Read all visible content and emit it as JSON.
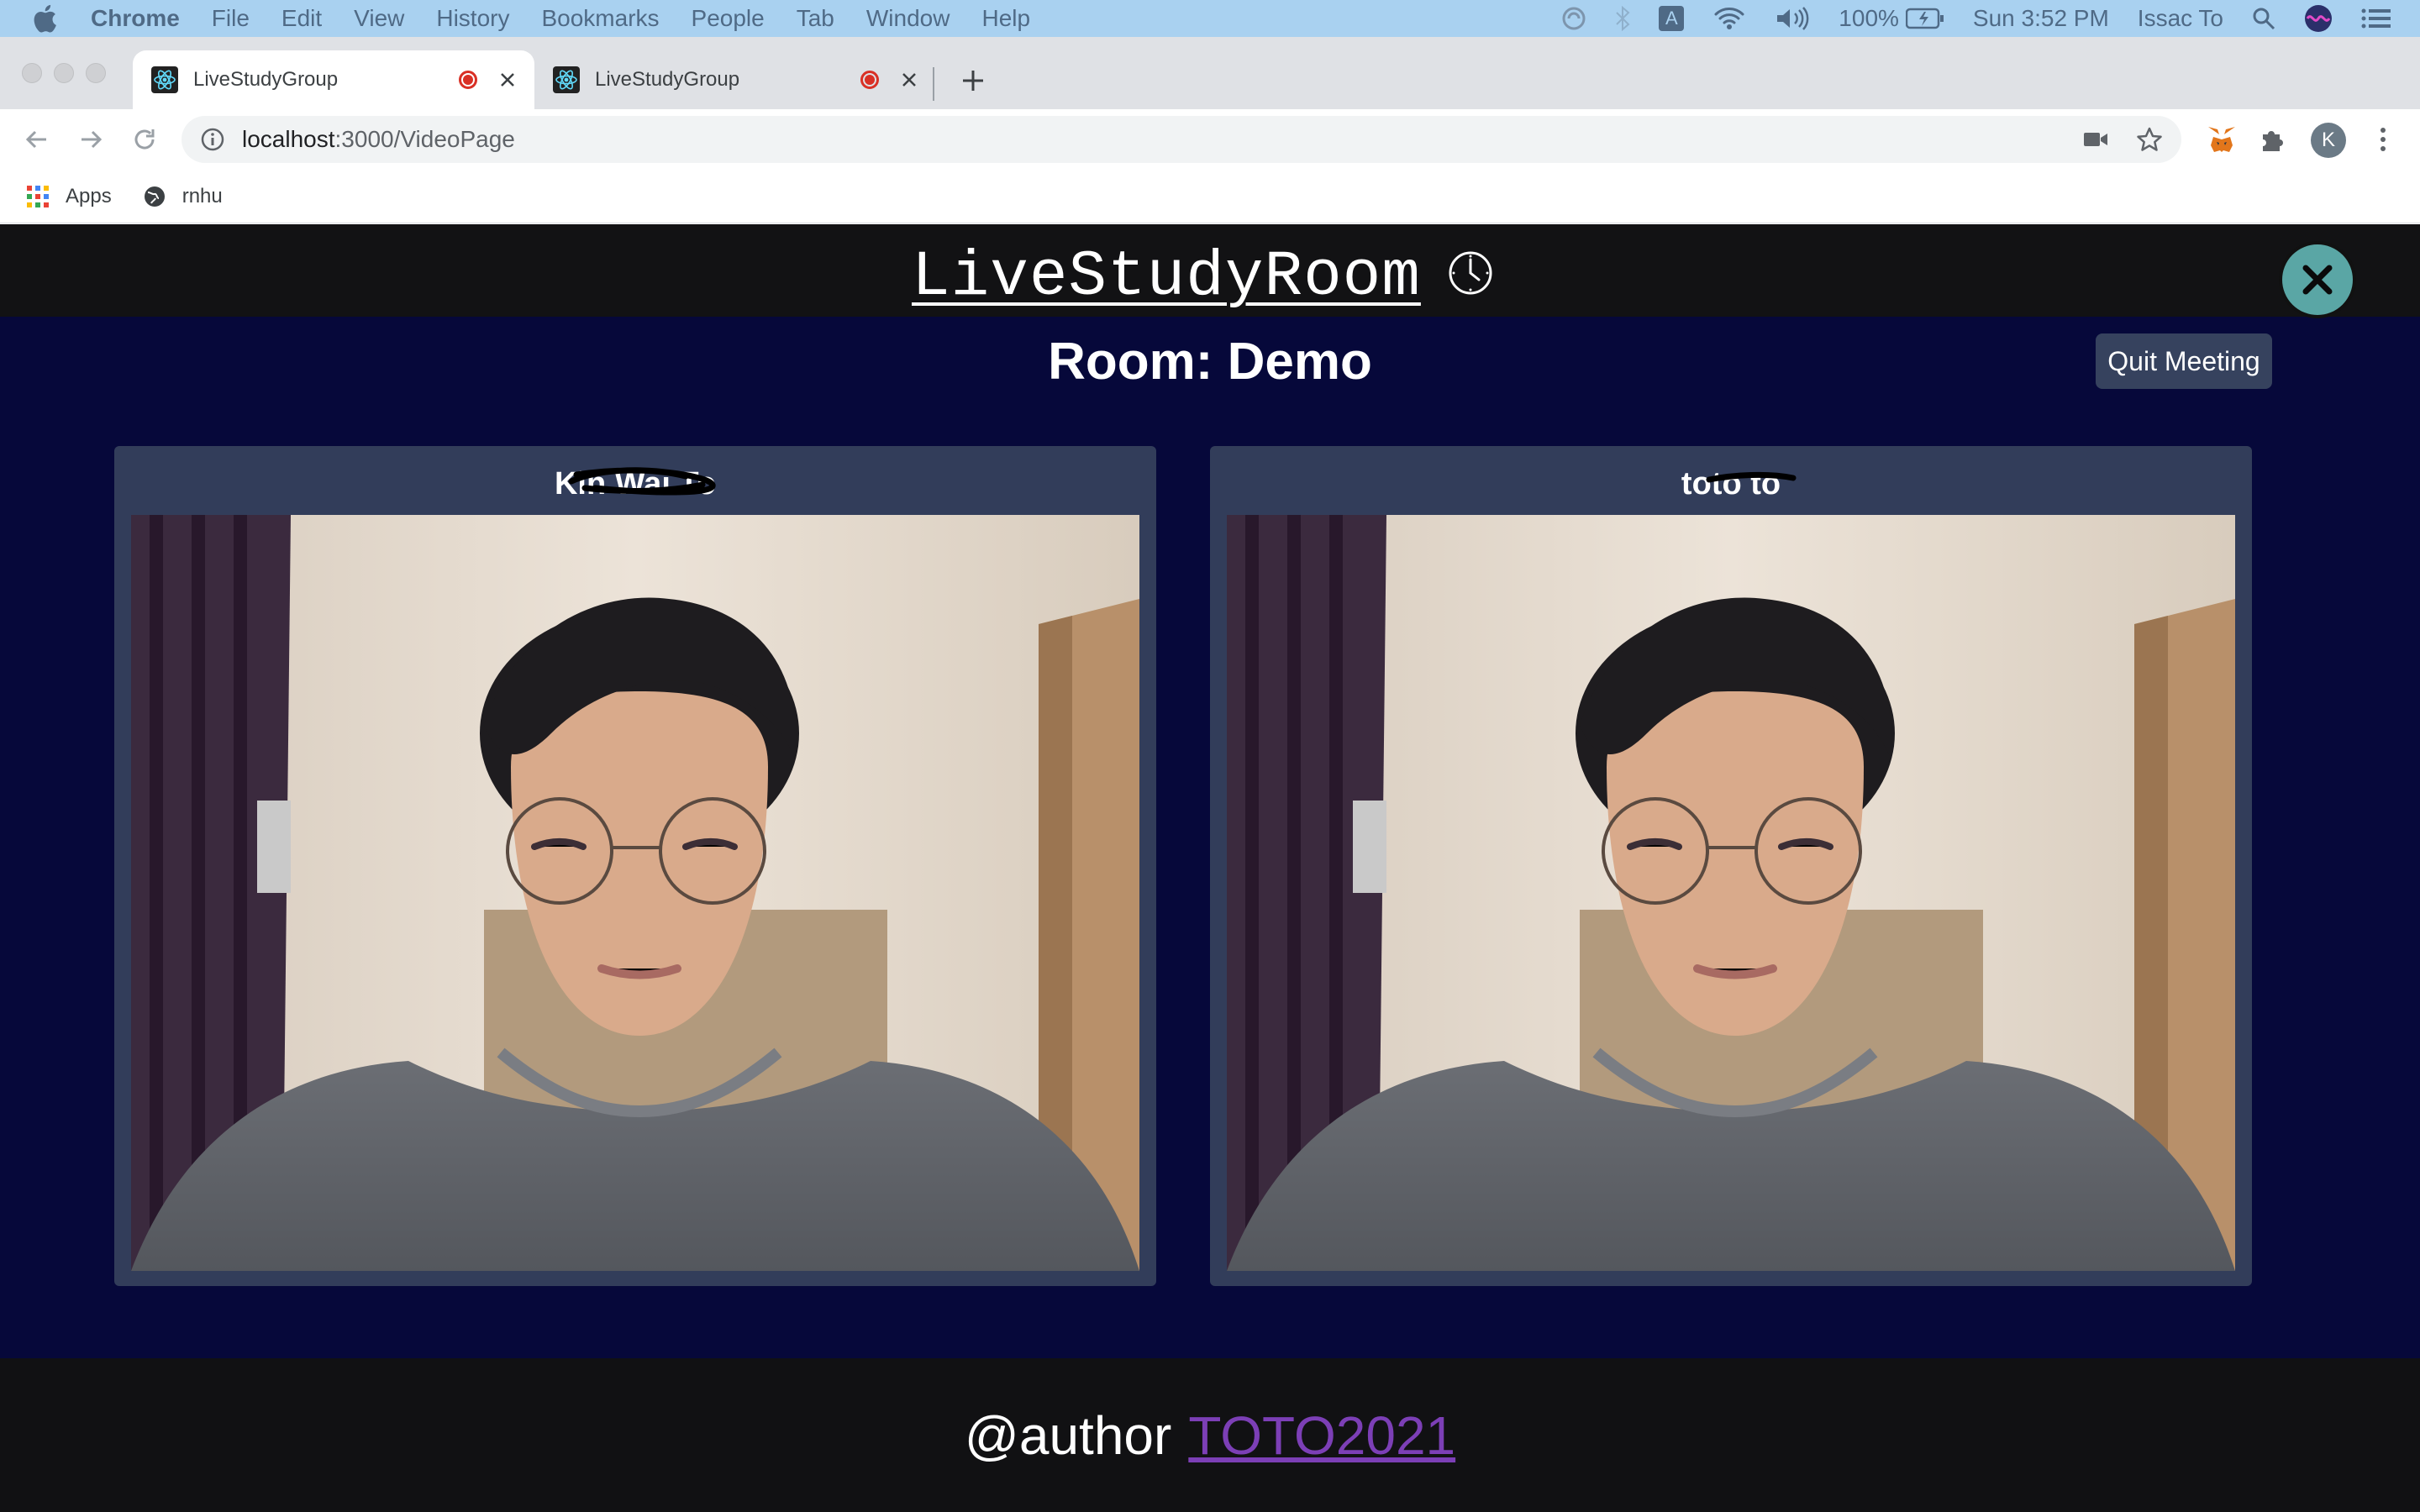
{
  "menubar": {
    "app_name": "Chrome",
    "items": [
      "File",
      "Edit",
      "View",
      "History",
      "Bookmarks",
      "People",
      "Tab",
      "Window",
      "Help"
    ],
    "battery": "100%",
    "clock": "Sun 3:52 PM",
    "user": "Issac To",
    "input_source": "A"
  },
  "tabs": [
    {
      "title": "LiveStudyGroup",
      "active": true,
      "recording": true
    },
    {
      "title": "LiveStudyGroup",
      "active": false,
      "recording": true
    }
  ],
  "toolbar": {
    "url_host": "localhost",
    "url_path": ":3000/VideoPage",
    "profile_initial": "K"
  },
  "bookmarks": [
    {
      "label": "Apps",
      "icon": "apps-grid-icon"
    },
    {
      "label": "rnhu",
      "icon": "globe-icon"
    }
  ],
  "app": {
    "brand": "LiveStudyRoom",
    "room_title": "Room: Demo",
    "quit_label": "Quit Meeting",
    "participants": [
      {
        "name": "Kin Wai To",
        "redacted": true
      },
      {
        "name": "toto to",
        "redacted": true
      }
    ],
    "footer_prefix": "@author",
    "footer_link": "TOTO2021"
  },
  "colors": {
    "menubar_bg": "#a9d1f0",
    "page_bg": "#06083a",
    "header_bg": "#121214",
    "card_bg": "#323d5a",
    "close_button": "#5aa6a5",
    "link": "#7c3fb6",
    "record_red": "#d93025"
  }
}
